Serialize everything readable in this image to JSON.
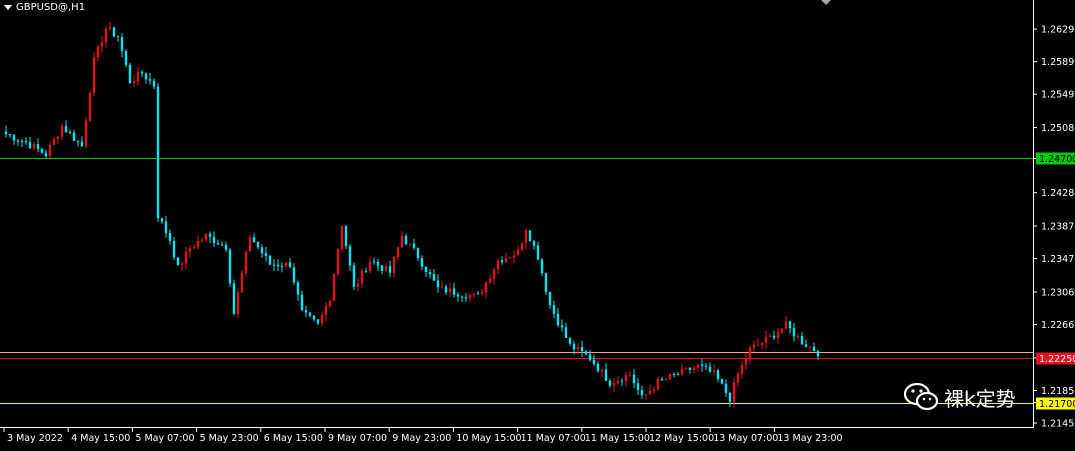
{
  "header": {
    "symbol": "GBPUSD@,H1"
  },
  "watermark": {
    "text": "裸k定势"
  },
  "colors": {
    "background": "#000000",
    "bull": "#e0141e",
    "bear": "#00e5ee",
    "axis": "#ffffff",
    "green_level": "#00c800",
    "red_level": "#e0141e",
    "yellow_level": "#ffff00",
    "pink_level": "#ff9a9a"
  },
  "chart_data": {
    "type": "candlestick",
    "ylim": [
      1.2145,
      1.265
    ],
    "y_ticks": [
      "1.26290",
      "1.25890",
      "1.25490",
      "1.25080",
      "1.24700",
      "1.24280",
      "1.23870",
      "1.23470",
      "1.23060",
      "1.22660",
      "1.22250",
      "1.21850",
      "1.21700",
      "1.21450"
    ],
    "x_ticks": [
      "3 May 2022",
      "4 May 15:00",
      "5 May 07:00",
      "5 May 23:00",
      "6 May 15:00",
      "9 May 07:00",
      "9 May 23:00",
      "10 May 15:00",
      "11 May 07:00",
      "11 May 15:00",
      "12 May 15:00",
      "13 May 07:00",
      "13 May 23:00"
    ],
    "horizontal_lines": [
      {
        "name": "green-level",
        "price": 1.247,
        "label": "1.24700"
      },
      {
        "name": "pink-level",
        "price": 1.2232,
        "label": "1.22320"
      },
      {
        "name": "red-level",
        "price": 1.2225,
        "label": "1.22250"
      },
      {
        "name": "yellow-level",
        "price": 1.217,
        "label": "1.21700"
      }
    ],
    "close_waypoints": [
      [
        0,
        1.25
      ],
      [
        5,
        1.249
      ],
      [
        10,
        1.2475
      ],
      [
        14,
        1.251
      ],
      [
        19,
        1.2485
      ],
      [
        22,
        1.259
      ],
      [
        25,
        1.263
      ],
      [
        28,
        1.262
      ],
      [
        31,
        1.2565
      ],
      [
        34,
        1.2575
      ],
      [
        37,
        1.256
      ],
      [
        38,
        1.24
      ],
      [
        41,
        1.237
      ],
      [
        43,
        1.2335
      ],
      [
        46,
        1.236
      ],
      [
        50,
        1.2375
      ],
      [
        55,
        1.2362
      ],
      [
        57,
        1.228
      ],
      [
        61,
        1.2375
      ],
      [
        66,
        1.234
      ],
      [
        71,
        1.234
      ],
      [
        74,
        1.228
      ],
      [
        78,
        1.2265
      ],
      [
        81,
        1.23
      ],
      [
        84,
        1.239
      ],
      [
        87,
        1.231
      ],
      [
        91,
        1.2345
      ],
      [
        96,
        1.233
      ],
      [
        99,
        1.2375
      ],
      [
        103,
        1.235
      ],
      [
        108,
        1.231
      ],
      [
        113,
        1.2305
      ],
      [
        118,
        1.23
      ],
      [
        123,
        1.2345
      ],
      [
        128,
        1.2355
      ],
      [
        130,
        1.2385
      ],
      [
        133,
        1.235
      ],
      [
        136,
        1.229
      ],
      [
        141,
        1.224
      ],
      [
        146,
        1.2225
      ],
      [
        151,
        1.2195
      ],
      [
        156,
        1.2205
      ],
      [
        159,
        1.2175
      ],
      [
        163,
        1.2195
      ],
      [
        168,
        1.2205
      ],
      [
        173,
        1.2215
      ],
      [
        177,
        1.2205
      ],
      [
        181,
        1.2175
      ],
      [
        183,
        1.2205
      ],
      [
        186,
        1.2235
      ],
      [
        191,
        1.225
      ],
      [
        195,
        1.2265
      ],
      [
        199,
        1.2245
      ],
      [
        203,
        1.2232
      ]
    ]
  }
}
